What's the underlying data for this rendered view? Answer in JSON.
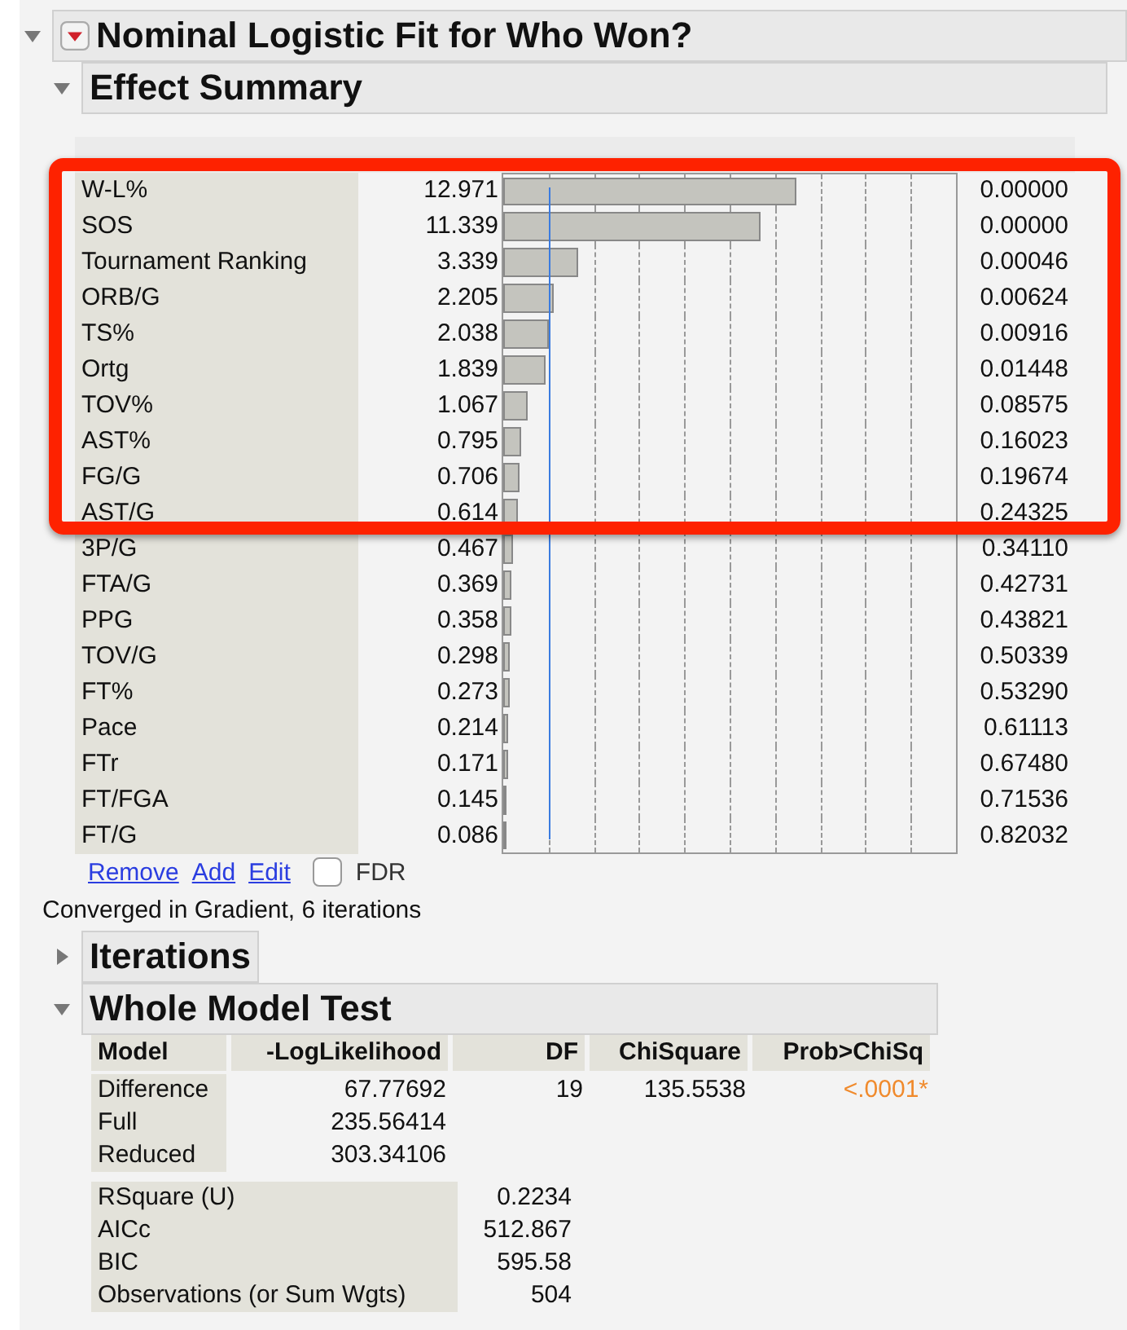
{
  "report": {
    "title": "Nominal Logistic Fit for Who Won?",
    "expanded": true
  },
  "effect_summary": {
    "title": "Effect Summary",
    "expanded": true,
    "rows": [
      {
        "source": "W-L%",
        "logworth": "12.971",
        "level": 0.649,
        "pvalue": "0.00000"
      },
      {
        "source": "SOS",
        "logworth": "11.339",
        "level": 0.567,
        "pvalue": "0.00000"
      },
      {
        "source": "Tournament Ranking",
        "logworth": "3.339",
        "level": 0.167,
        "pvalue": "0.00046"
      },
      {
        "source": "ORB/G",
        "logworth": "2.205",
        "level": 0.11,
        "pvalue": "0.00624"
      },
      {
        "source": "TS%",
        "logworth": "2.038",
        "level": 0.102,
        "pvalue": "0.00916"
      },
      {
        "source": "Ortg",
        "logworth": "1.839",
        "level": 0.092,
        "pvalue": "0.01448"
      },
      {
        "source": "TOV%",
        "logworth": "1.067",
        "level": 0.053,
        "pvalue": "0.08575"
      },
      {
        "source": "AST%",
        "logworth": "0.795",
        "level": 0.04,
        "pvalue": "0.16023"
      },
      {
        "source": "FG/G",
        "logworth": "0.706",
        "level": 0.035,
        "pvalue": "0.19674"
      },
      {
        "source": "AST/G",
        "logworth": "0.614",
        "level": 0.031,
        "pvalue": "0.24325"
      },
      {
        "source": "3P/G",
        "logworth": "0.467",
        "level": 0.023,
        "pvalue": "0.34110"
      },
      {
        "source": "FTA/G",
        "logworth": "0.369",
        "level": 0.018,
        "pvalue": "0.42731"
      },
      {
        "source": "PPG",
        "logworth": "0.358",
        "level": 0.018,
        "pvalue": "0.43821"
      },
      {
        "source": "TOV/G",
        "logworth": "0.298",
        "level": 0.015,
        "pvalue": "0.50339"
      },
      {
        "source": "FT%",
        "logworth": "0.273",
        "level": 0.014,
        "pvalue": "0.53290"
      },
      {
        "source": "Pace",
        "logworth": "0.214",
        "level": 0.011,
        "pvalue": "0.61113"
      },
      {
        "source": "FTr",
        "logworth": "0.171",
        "level": 0.009,
        "pvalue": "0.67480"
      },
      {
        "source": "FT/FGA",
        "logworth": "0.145",
        "level": 0.007,
        "pvalue": "0.71536"
      },
      {
        "source": "FT/G",
        "logworth": "0.086",
        "level": 0.004,
        "pvalue": "0.82032"
      }
    ],
    "links": [
      "Remove",
      "Add",
      "Edit"
    ],
    "fdr": {
      "label": "FDR",
      "checked": false
    }
  },
  "converged": "Converged in Gradient, 6 iterations",
  "iterations": {
    "title": "Iterations",
    "expanded": false
  },
  "whole_model_test": {
    "title": "Whole Model Test",
    "expanded": true,
    "columns": [
      "Model",
      "-LogLikelihood",
      "DF",
      "ChiSquare",
      "Prob>ChiSq"
    ],
    "rows": [
      {
        "cells": [
          "Difference",
          "67.77692",
          "19",
          "135.5538",
          "<.0001*"
        ],
        "significant": true
      },
      {
        "cells": [
          "Full",
          "235.56414"
        ]
      },
      {
        "cells": [
          "Reduced",
          "303.34106"
        ]
      }
    ],
    "stats": [
      {
        "label": "RSquare (U)",
        "value": "0.2234"
      },
      {
        "label": "AICc",
        "value": "512.867"
      },
      {
        "label": "BIC",
        "value": "595.58"
      },
      {
        "label": "Observations (or Sum Wgts)",
        "value": "504"
      }
    ]
  },
  "highlight": {
    "shown": true
  }
}
